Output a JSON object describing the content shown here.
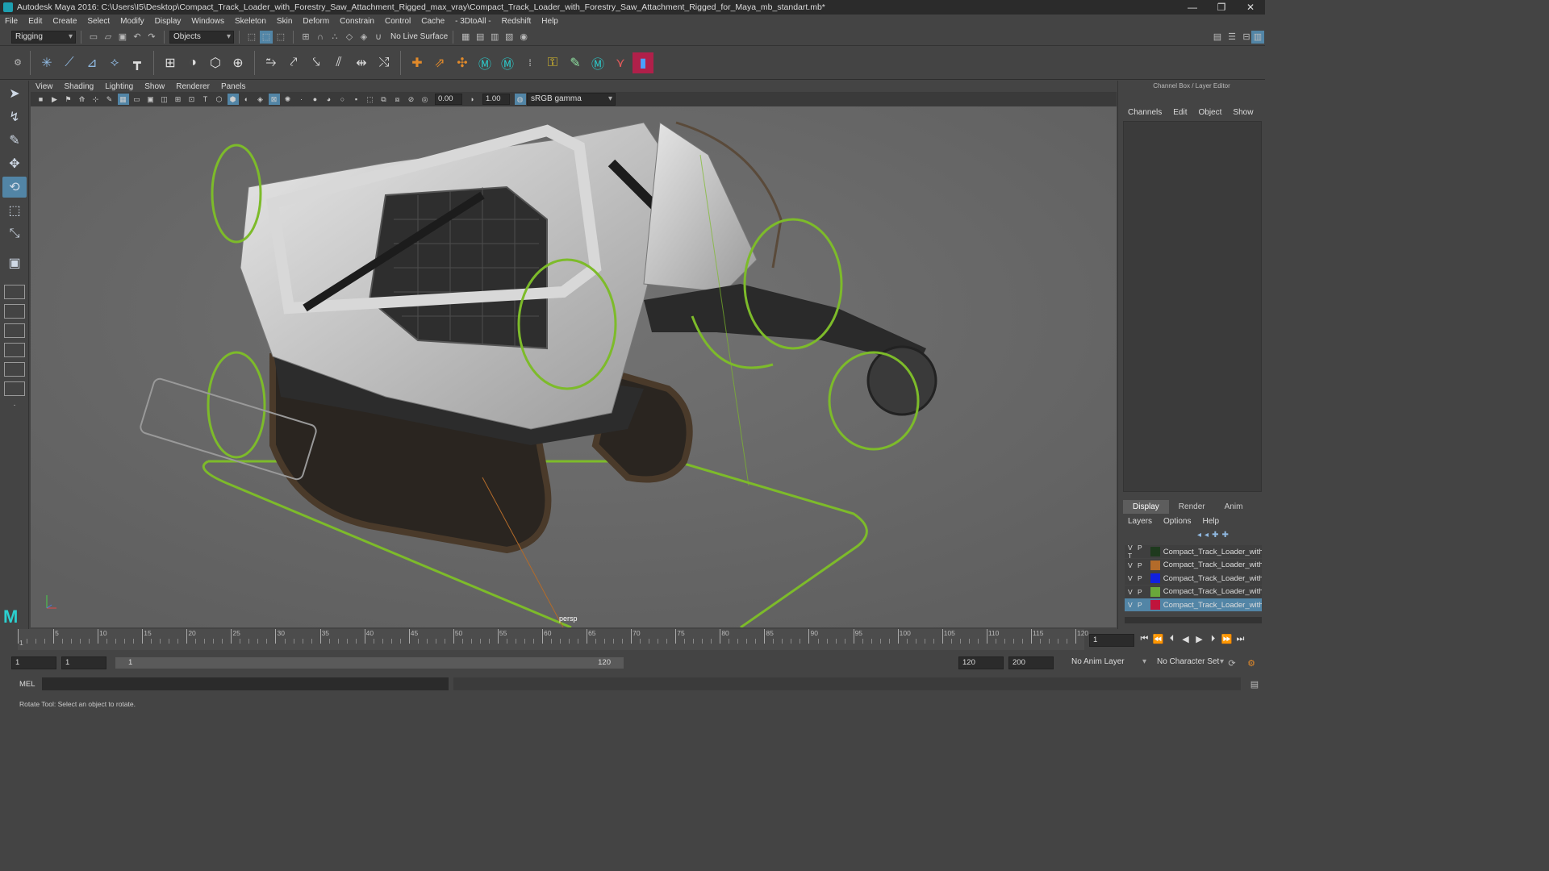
{
  "window": {
    "title": "Autodesk Maya 2016: C:\\Users\\I5\\Desktop\\Compact_Track_Loader_with_Forestry_Saw_Attachment_Rigged_max_vray\\Compact_Track_Loader_with_Forestry_Saw_Attachment_Rigged_for_Maya_mb_standart.mb*",
    "controls": [
      "—",
      "❐",
      "✕"
    ]
  },
  "menubar": [
    "File",
    "Edit",
    "Create",
    "Select",
    "Modify",
    "Display",
    "Windows",
    "Skeleton",
    "Skin",
    "Deform",
    "Constrain",
    "Control",
    "Cache",
    "- 3DtoAll -",
    "Redshift",
    "Help"
  ],
  "statusline": {
    "mode": "Rigging",
    "selection_mask": "Objects",
    "live_surface": "No Live Surface"
  },
  "panel": {
    "menu": [
      "View",
      "Shading",
      "Lighting",
      "Show",
      "Renderer",
      "Panels"
    ],
    "exposure": "0.00",
    "gamma": "1.00",
    "color_space": "sRGB gamma",
    "camera_label": "persp"
  },
  "channel_box": {
    "title": "Channel Box / Layer Editor",
    "menu": [
      "Channels",
      "Edit",
      "Object",
      "Show"
    ]
  },
  "layer_editor": {
    "tabs": [
      "Display",
      "Render",
      "Anim"
    ],
    "menu": [
      "Layers",
      "Options",
      "Help"
    ],
    "layers": [
      {
        "vp": "V P T",
        "color": "#1e3a1e",
        "name": "Compact_Track_Loader_with_"
      },
      {
        "vp": "V P",
        "color": "#b36b2a",
        "name": "Compact_Track_Loader_with_"
      },
      {
        "vp": "V P",
        "color": "#1020e0",
        "name": "Compact_Track_Loader_with_"
      },
      {
        "vp": "V P",
        "color": "#6aa83a",
        "name": "Compact_Track_Loader_with_"
      },
      {
        "vp": "V P",
        "color": "#c0143c",
        "name": "Compact_Track_Loader_with_"
      }
    ]
  },
  "timeline": {
    "ticks": [
      "1",
      "5",
      "10",
      "15",
      "20",
      "25",
      "30",
      "35",
      "40",
      "45",
      "50",
      "55",
      "60",
      "65",
      "70",
      "75",
      "80",
      "85",
      "90",
      "95",
      "100",
      "105",
      "110",
      "115",
      "120"
    ],
    "current_frame": "1"
  },
  "range": {
    "start": "1",
    "playback_start": "1",
    "slider_start": "1",
    "slider_end": "120",
    "playback_end": "120",
    "end": "200",
    "anim_layer": "No Anim Layer",
    "character_set": "No Character Set"
  },
  "command_line": {
    "lang": "MEL"
  },
  "help_line": "Rotate Tool: Select an object to rotate."
}
